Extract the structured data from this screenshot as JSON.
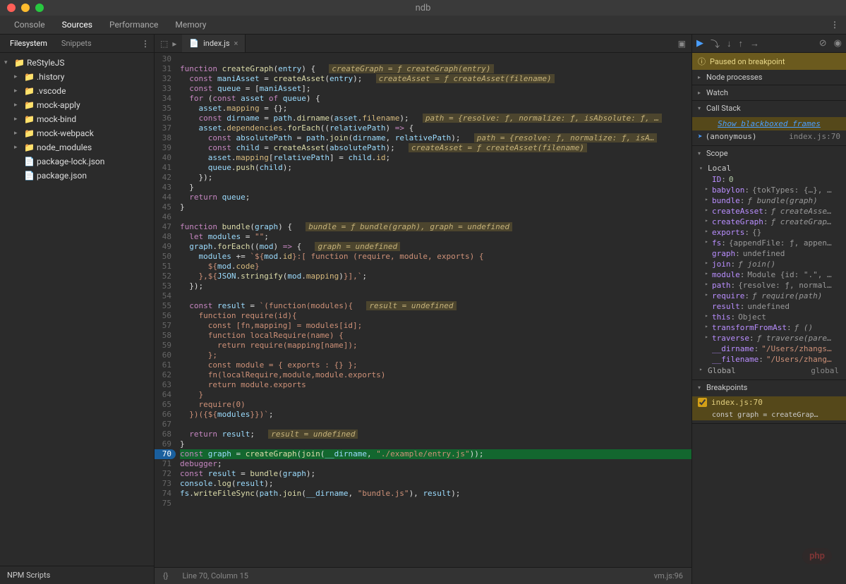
{
  "window": {
    "title": "ndb"
  },
  "mainTabs": {
    "items": [
      "Console",
      "Sources",
      "Performance",
      "Memory"
    ],
    "active": 1
  },
  "leftTabs": {
    "items": [
      "Filesystem",
      "Snippets"
    ],
    "active": 0
  },
  "tree": {
    "root": "ReStyleJS",
    "folders": [
      ".history",
      ".vscode",
      "mock-apply",
      "mock-bind",
      "mock-webpack",
      "node_modules"
    ],
    "greenFolders": [
      "mock-apply",
      "mock-bind",
      "mock-webpack",
      "node_modules"
    ],
    "files": [
      "package-lock.json",
      "package.json"
    ]
  },
  "npmLabel": "NPM Scripts",
  "file": {
    "name": "index.js",
    "icon": "📄"
  },
  "statusBar": {
    "braces": "{}",
    "pos": "Line 70, Column 15",
    "src": "vm.js:96"
  },
  "code": {
    "start": 30,
    "exec": 70,
    "lines": [
      "",
      "<kw>function</kw> <fn>createGraph</fn>(<var>entry</var>) {  <hint>createGraph = ƒ createGraph(entry)</hint>",
      "  <kw>const</kw> <var>maniAsset</var> = <fn>createAsset</fn>(<var>entry</var>);  <hint>createAsset = ƒ createAsset(filename)</hint>",
      "  <kw>const</kw> <var>queue</var> = [<var>maniAsset</var>];",
      "  <kw>for</kw> (<kw>const</kw> <var>asset</var> <kw>of</kw> <var>queue</var>) {",
      "    <var>asset</var>.<prop>mapping</prop> = {};",
      "    <kw>const</kw> <var>dirname</var> = <var>path</var>.<fn>dirname</fn>(<var>asset</var>.<prop>filename</prop>);  <hint>path = {resolve: ƒ, normalize: ƒ, isAbsolute: ƒ, …</hint>",
      "    <var>asset</var>.<prop>dependencies</prop>.<fn>forEach</fn>((<var>relativePath</var>) <kw>=&gt;</kw> {",
      "      <kw>const</kw> <var>absolutePath</var> = <var>path</var>.<fn>join</fn>(<var>dirname</var>, <var>relativePath</var>);  <hint>path = {resolve: ƒ, normalize: ƒ, isA…</hint>",
      "      <kw>const</kw> <var>child</var> = <fn>createAsset</fn>(<var>absolutePath</var>);  <hint>createAsset = ƒ createAsset(filename)</hint>",
      "      <var>asset</var>.<prop>mapping</prop>[<var>relativePath</var>] = <var>child</var>.<prop>id</prop>;",
      "      <var>queue</var>.<fn>push</fn>(<var>child</var>);",
      "    });",
      "  }",
      "  <kw>return</kw> <var>queue</var>;",
      "}",
      "",
      "<kw>function</kw> <fn>bundle</fn>(<var>graph</var>) {  <hint>bundle = ƒ bundle(graph), graph = undefined</hint>",
      "  <kw>let</kw> <var>modules</var> = <str>\"\"</str>;",
      "  <var>graph</var>.<fn>forEach</fn>((<var>mod</var>) <kw>=&gt;</kw> {  <hint>graph = undefined</hint>",
      "    <var>modules</var> += <str>`${</str><var>mod</var>.<prop>id</prop><str>}:[ function (require, module, exports) {</str>",
      "<str>      ${</str><var>mod</var>.<prop>code</prop><str>}</str>",
      "<str>    },${</str><var>JSON</var>.<fn>stringify</fn>(<var>mod</var>.<prop>mapping</prop>)<str>}],`</str>;",
      "  });",
      "",
      "  <kw>const</kw> <var>result</var> = <str>`(function(modules){</str>  <hint>result = undefined</hint>",
      "<str>    function require(id){</str>",
      "<str>      const [fn,mapping] = modules[id];</str>",
      "<str>      function localRequire(name) {</str>",
      "<str>        return require(mapping[name]);</str>",
      "<str>      };</str>",
      "<str>      const module = { exports : {} };</str>",
      "<str>      fn(localRequire,module,module.exports)</str>",
      "<str>      return module.exports</str>",
      "<str>    }</str>",
      "<str>    require(0)</str>",
      "<str>  })({${</str><var>modules</var><str>}})`</str>;",
      "",
      "  <kw>return</kw> <var>result</var>;  <hint>result = undefined</hint>",
      "}",
      "<kw>const</kw> <var>graph</var> = <fn>createGraph</fn>(<fn>join</fn>(<var>__dirname</var>, <str>\"./example/entry.js\"</str>));",
      "<kw>debugger</kw>;",
      "<kw>const</kw> <var>result</var> = <fn>bundle</fn>(<var>graph</var>);",
      "<var>console</var>.<fn>log</fn>(<var>result</var>);",
      "<var>fs</var>.<fn>writeFileSync</fn>(<var>path</var>.<fn>join</fn>(<var>__dirname</var>, <str>\"bundle.js\"</str>), <var>result</var>);",
      ""
    ]
  },
  "debugger": {
    "banner": "Paused on breakpoint",
    "sections": {
      "nodeProc": "Node processes",
      "watch": "Watch",
      "callStack": "Call Stack",
      "scope": "Scope",
      "breakpoints": "Breakpoints"
    },
    "blackbox": "Show blackboxed frames",
    "frame": {
      "name": "(anonymous)",
      "loc": "index.js:70"
    },
    "scopeLocal": "Local",
    "scopeItems": [
      {
        "k": "ID",
        "v": "0",
        "cls": "num",
        "caret": ""
      },
      {
        "k": "babylon",
        "v": "{tokTypes: {…}, …",
        "cls": "obj",
        "caret": "▸"
      },
      {
        "k": "bundle",
        "v": "ƒ bundle(graph)",
        "cls": "fn",
        "caret": "▸"
      },
      {
        "k": "createAsset",
        "v": "ƒ createAsse…",
        "cls": "fn",
        "caret": "▸"
      },
      {
        "k": "createGraph",
        "v": "ƒ createGrap…",
        "cls": "fn",
        "caret": "▸"
      },
      {
        "k": "exports",
        "v": "{}",
        "cls": "obj",
        "caret": "▸"
      },
      {
        "k": "fs",
        "v": "{appendFile: ƒ, appen…",
        "cls": "obj",
        "caret": "▸"
      },
      {
        "k": "graph",
        "v": "undefined",
        "cls": "obj",
        "caret": ""
      },
      {
        "k": "join",
        "v": "ƒ join()",
        "cls": "fn",
        "caret": "▸"
      },
      {
        "k": "module",
        "v": "Module {id: \".\", …",
        "cls": "obj",
        "caret": "▸"
      },
      {
        "k": "path",
        "v": "{resolve: ƒ, normal…",
        "cls": "obj",
        "caret": "▸"
      },
      {
        "k": "require",
        "v": "ƒ require(path)",
        "cls": "fn",
        "caret": "▸"
      },
      {
        "k": "result",
        "v": "undefined",
        "cls": "obj",
        "caret": ""
      },
      {
        "k": "this",
        "v": "Object",
        "cls": "obj",
        "caret": "▸"
      },
      {
        "k": "transformFromAst",
        "v": "ƒ ()",
        "cls": "fn",
        "caret": "▸"
      },
      {
        "k": "traverse",
        "v": "ƒ traverse(pare…",
        "cls": "fn",
        "caret": "▸"
      },
      {
        "k": "__dirname",
        "v": "\"/Users/zhangs…",
        "cls": "str",
        "caret": ""
      },
      {
        "k": "__filename",
        "v": "\"/Users/zhang…",
        "cls": "str",
        "caret": ""
      }
    ],
    "global": {
      "label": "Global",
      "val": "global"
    },
    "breakpoint": {
      "label": "index.js:70",
      "code": "const graph = createGrap…"
    }
  },
  "watermark": "php"
}
